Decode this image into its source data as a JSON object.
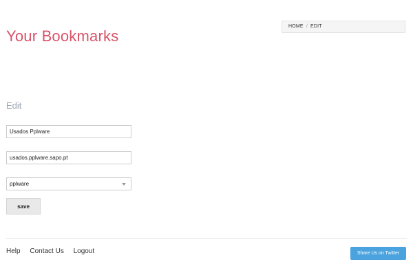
{
  "header": {
    "title": "Your Bookmarks",
    "breadcrumb": {
      "home": "HOME",
      "separator": "/",
      "current": "EDIT"
    }
  },
  "form": {
    "heading": "Edit",
    "name_value": "Usados Pplware",
    "url_value": "usados.pplware.sapo.pt",
    "category_selected": "pplware",
    "save_label": "save"
  },
  "footer": {
    "links": [
      "Help",
      "Contact Us",
      "Logout"
    ],
    "twitter_label": "Share Us on Twitter"
  },
  "colors": {
    "title": "#d9536a",
    "heading": "#9aa4b2",
    "twitter_button": "#4aa3df"
  }
}
